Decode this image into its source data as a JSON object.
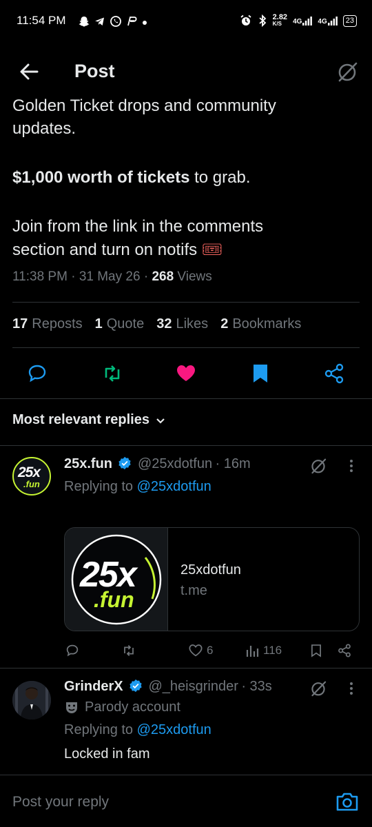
{
  "status_bar": {
    "time": "11:54 PM",
    "net_speed": "2.82",
    "net_unit": "K/S",
    "signal1": "4G",
    "signal2": "4G",
    "battery": "23"
  },
  "header": {
    "title": "Post"
  },
  "post": {
    "line1": "Golden Ticket drops and community",
    "line2": "updates.",
    "bold_part": "$1,000 worth of tickets",
    "rest_part": " to grab.",
    "line4": "Join from the link in the comments",
    "line5": "section and turn on notifs",
    "time": "11:38 PM",
    "date": "31 May 26",
    "views": "268",
    "views_label": "Views",
    "ticket_emoji": "🎟"
  },
  "stats": [
    {
      "num": "17",
      "label": "Reposts"
    },
    {
      "num": "1",
      "label": "Quote"
    },
    {
      "num": "32",
      "label": "Likes"
    },
    {
      "num": "2",
      "label": "Bookmarks"
    }
  ],
  "sort": {
    "label": "Most relevant replies"
  },
  "replies": [
    {
      "name": "25x.fun",
      "handle": "@25xdotfun",
      "time": "16m",
      "replying_prefix": "Replying to",
      "replying_to": "@25xdotfun",
      "avatar_text_top": "25x",
      "avatar_text_bottom": ".fun",
      "card": {
        "logo_top": "25x",
        "logo_bottom": ".fun",
        "title": "25xdotfun",
        "domain": "t.me"
      },
      "likes": "6",
      "views": "116"
    },
    {
      "name": "GrinderX",
      "handle": "@_heisgrinder",
      "time": "33s",
      "label": "Parody account",
      "replying_prefix": "Replying to",
      "replying_to": "@25xdotfun",
      "text": "Locked in fam"
    }
  ],
  "reply_bar": {
    "placeholder": "Post your reply"
  },
  "colors": {
    "accent": "#1d9bf0",
    "repost": "#00ba7c",
    "like": "#f91880",
    "lime": "#c6f432"
  }
}
